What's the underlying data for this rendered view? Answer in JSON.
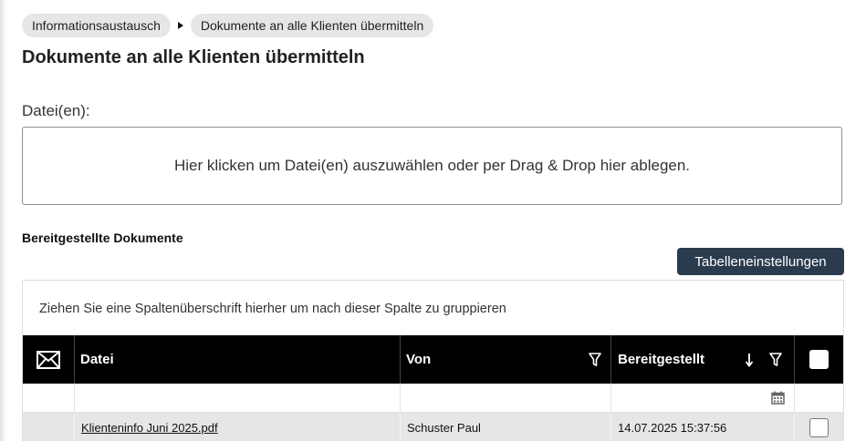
{
  "breadcrumb": {
    "items": [
      {
        "label": "Informationsaustausch"
      },
      {
        "label": "Dokumente an alle Klienten übermitteln"
      }
    ]
  },
  "page": {
    "title": "Dokumente an alle Klienten übermitteln"
  },
  "upload": {
    "label": "Datei(en):",
    "dropzone_text": "Hier klicken um Datei(en) auszuwählen oder per Drag & Drop hier ablegen."
  },
  "documents": {
    "section_title": "Bereitgestellte Dokumente",
    "settings_button": "Tabelleneinstellungen",
    "group_panel_text": "Ziehen Sie eine Spaltenüberschrift hierher um nach dieser Spalte zu gruppieren",
    "columns": [
      {
        "key": "mail",
        "icon": "envelope-icon"
      },
      {
        "key": "datei",
        "label": "Datei"
      },
      {
        "key": "von",
        "label": "Von",
        "icon": "filter-icon"
      },
      {
        "key": "bereitgestellt",
        "label": "Bereitgestellt",
        "icons": [
          "sort-descending-icon",
          "filter-icon"
        ]
      },
      {
        "key": "select",
        "icon": "select-all-checkbox"
      }
    ],
    "filter_row": {
      "bereitgestellt_icon": "calendar-icon"
    },
    "rows": [
      {
        "datei": "Klienteninfo Juni 2025.pdf",
        "von": "Schuster Paul",
        "bereitgestellt": "14.07.2025 15:37:56",
        "selected": false
      }
    ]
  },
  "colors": {
    "header_bg": "#000000",
    "button_bg": "#2b3b4e",
    "row_bg": "#e6e6e6",
    "crumb_bg": "#e6e6e6"
  }
}
